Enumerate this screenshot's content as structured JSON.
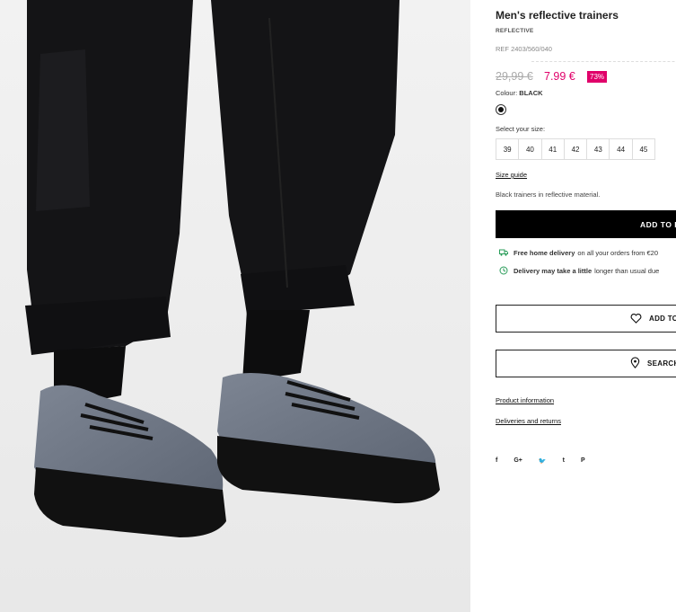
{
  "product": {
    "title": "Men's reflective trainers",
    "collection": "REFLECTIVE",
    "ref": "REF 2403/560/040",
    "old_price": "29,99 €",
    "new_price": "7.99 €",
    "discount": "73%",
    "colour_label": "Colour:",
    "colour_value": "BLACK",
    "swatch_color": "#111111",
    "size_label": "Select your size:",
    "sizes": [
      "39",
      "40",
      "41",
      "42",
      "43",
      "44",
      "45"
    ],
    "size_guide": "Size guide",
    "description": "Black trainers in reflective material."
  },
  "actions": {
    "add_to_bag": "ADD TO B",
    "wishlist": "ADD TO",
    "search_store": "SEARCH"
  },
  "notices": {
    "delivery_bold": "Free home delivery",
    "delivery_text": "on all your orders from €20",
    "delay_bold": "Delivery may take a little",
    "delay_text": "longer than usual due"
  },
  "links": {
    "product_info": "Product information",
    "deliveries": "Deliveries and returns"
  },
  "social": {
    "facebook": "f",
    "google": "G+",
    "twitter": "🐦",
    "tumblr": "t",
    "pinterest": "P"
  },
  "colors": {
    "accent": "#e0006a",
    "button": "#000000"
  }
}
